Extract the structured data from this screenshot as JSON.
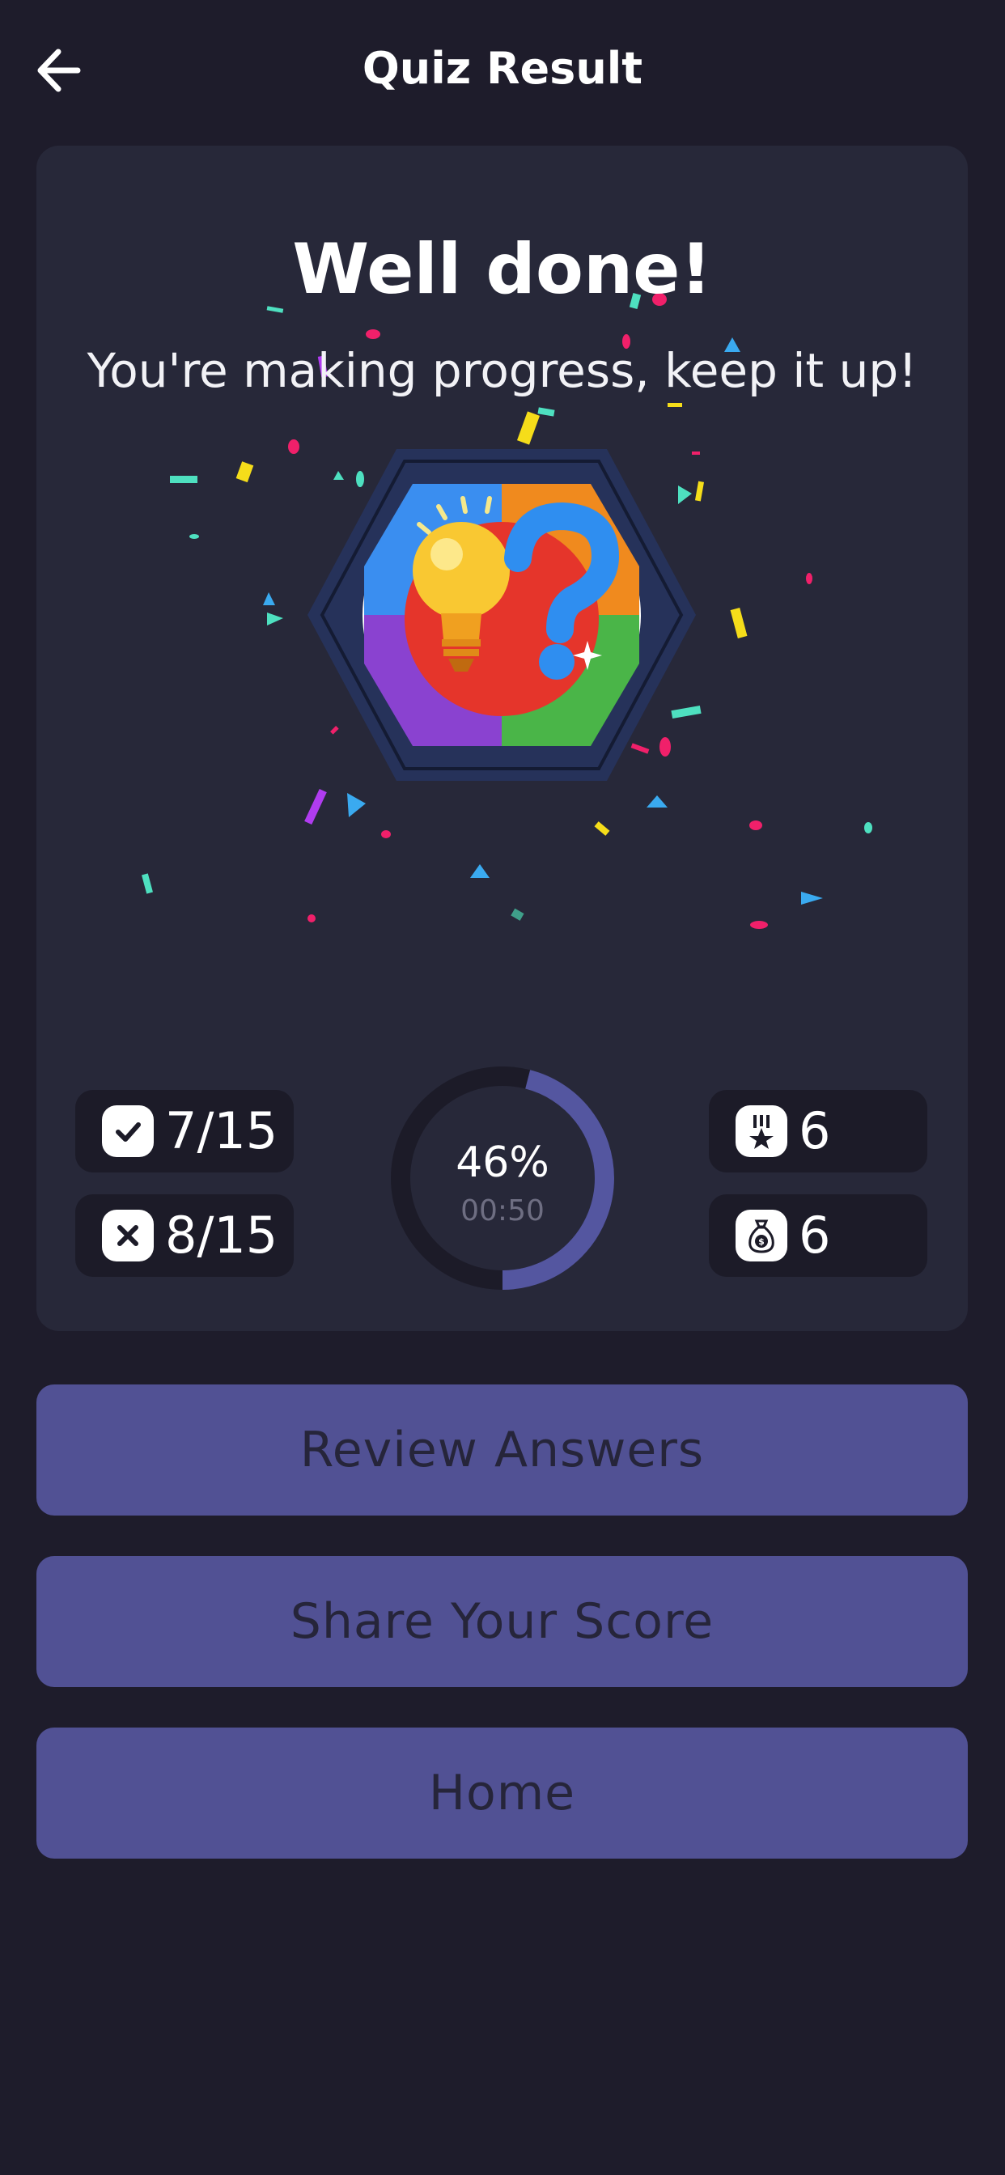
{
  "header": {
    "title": "Quiz Result",
    "back_icon": "arrow-left-icon"
  },
  "result": {
    "headline": "Well done!",
    "message": "You're making progress, keep it up!",
    "badge_icon": "lightbulb-question-icon"
  },
  "stats": {
    "correct": {
      "icon": "check-icon",
      "value": "7/15"
    },
    "wrong": {
      "icon": "close-icon",
      "value": "8/15"
    },
    "medals": {
      "icon": "medal-icon",
      "value": "6"
    },
    "coins": {
      "icon": "money-bag-icon",
      "value": "6"
    }
  },
  "score": {
    "percent_label": "46%",
    "progress": 0.46,
    "time": "00:50"
  },
  "actions": {
    "review": "Review Answers",
    "share": "Share Your Score",
    "home": "Home"
  },
  "colors": {
    "background": "#1e1c2b",
    "card": "#272839",
    "button": "#515194",
    "button_text": "#26253a",
    "ring_progress": "#5456a0",
    "ring_track": "#1c1b28"
  }
}
